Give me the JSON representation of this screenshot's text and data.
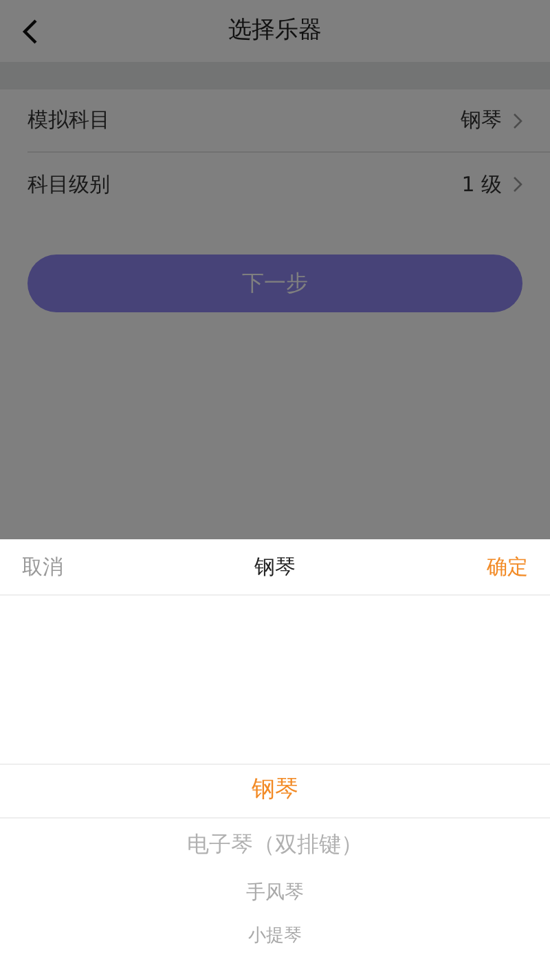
{
  "header": {
    "title": "选择乐器"
  },
  "rows": [
    {
      "label": "模拟科目",
      "value": "钢琴"
    },
    {
      "label": "科目级别",
      "value": "1 级"
    }
  ],
  "next_button": {
    "label": "下一步"
  },
  "picker": {
    "cancel": "取消",
    "title": "钢琴",
    "confirm": "确定",
    "options": [
      {
        "label": "钢琴",
        "selected": true
      },
      {
        "label": "电子琴（双排键）",
        "selected": false
      },
      {
        "label": "手风琴",
        "selected": false
      },
      {
        "label": "小提琴",
        "selected": false
      }
    ]
  }
}
